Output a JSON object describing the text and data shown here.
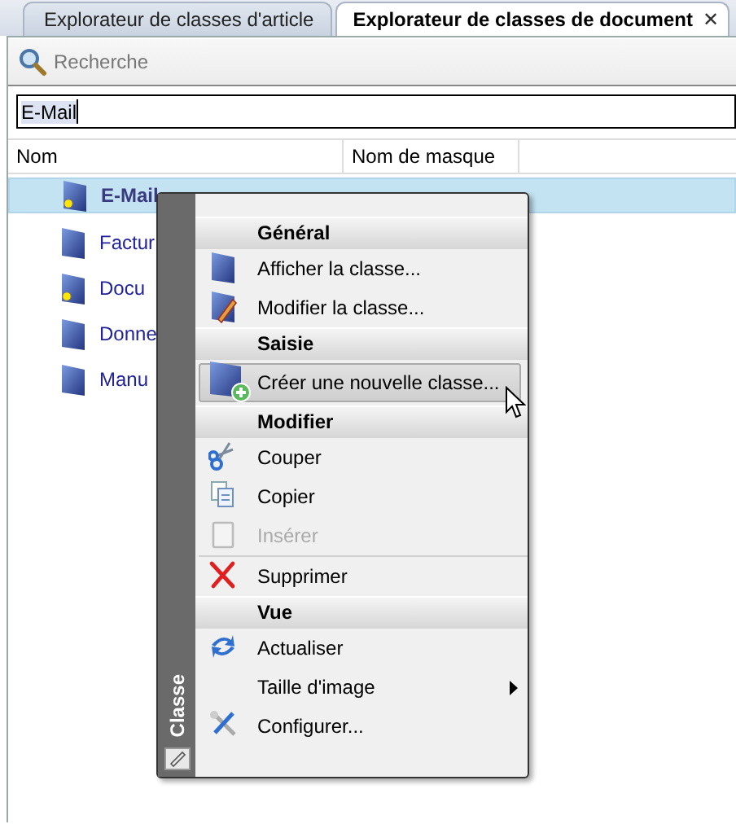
{
  "tabs": [
    {
      "label": "Explorateur de classes d'article",
      "selected": false,
      "closable": false
    },
    {
      "label": "Explorateur de classes de document",
      "selected": true,
      "closable": true
    }
  ],
  "close_glyph": "✕",
  "search": {
    "placeholder": "Recherche"
  },
  "filter": {
    "value": "E-Mail"
  },
  "table": {
    "columns": [
      "Nom",
      "Nom de masque"
    ],
    "rows": [
      {
        "name": "E-Mail",
        "selected": true,
        "marked": true
      },
      {
        "name": "Factur",
        "selected": false,
        "marked": false
      },
      {
        "name": "Docu",
        "selected": false,
        "marked": true
      },
      {
        "name": "Donne",
        "selected": false,
        "marked": false
      },
      {
        "name": "Manu",
        "selected": false,
        "marked": false
      }
    ]
  },
  "context_menu": {
    "side_label": "Classe",
    "items": [
      {
        "kind": "header",
        "label": "Général"
      },
      {
        "kind": "item",
        "label": "Afficher la classe...",
        "disabled": false,
        "highlighted": false,
        "submenu": false
      },
      {
        "kind": "item",
        "label": "Modifier la classe...",
        "disabled": false,
        "highlighted": false,
        "submenu": false
      },
      {
        "kind": "header",
        "label": "Saisie"
      },
      {
        "kind": "item",
        "label": "Créer une nouvelle classe...",
        "disabled": false,
        "highlighted": true,
        "submenu": false
      },
      {
        "kind": "header",
        "label": "Modifier"
      },
      {
        "kind": "item",
        "label": "Couper",
        "disabled": false,
        "highlighted": false,
        "submenu": false
      },
      {
        "kind": "item",
        "label": "Copier",
        "disabled": false,
        "highlighted": false,
        "submenu": false
      },
      {
        "kind": "item",
        "label": "Insérer",
        "disabled": true,
        "highlighted": false,
        "submenu": false
      },
      {
        "kind": "separator"
      },
      {
        "kind": "item",
        "label": "Supprimer",
        "disabled": false,
        "highlighted": false,
        "submenu": false
      },
      {
        "kind": "header",
        "label": "Vue"
      },
      {
        "kind": "item",
        "label": "Actualiser",
        "disabled": false,
        "highlighted": false,
        "submenu": false
      },
      {
        "kind": "item",
        "label": "Taille d'image",
        "disabled": false,
        "highlighted": false,
        "submenu": true
      },
      {
        "kind": "item",
        "label": "Configurer...",
        "disabled": false,
        "highlighted": false,
        "submenu": false
      }
    ]
  }
}
